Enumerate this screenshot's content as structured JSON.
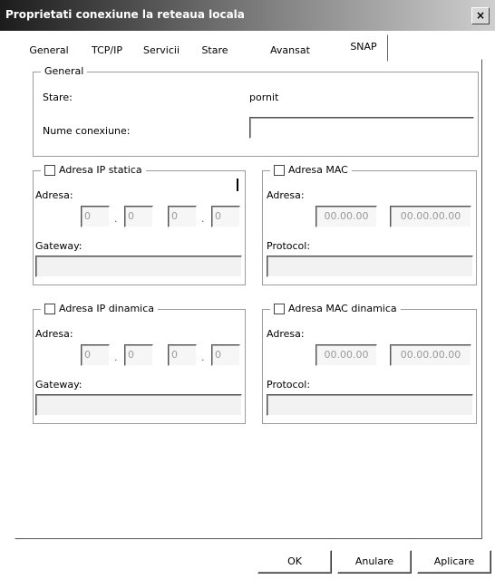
{
  "window": {
    "title": "Proprietati conexiune la reteaua locala",
    "close_glyph": "×"
  },
  "tabs": [
    {
      "label": "General"
    },
    {
      "label": "TCP/IP"
    },
    {
      "label": "Servicii"
    },
    {
      "label": "Stare"
    },
    {
      "label": "Avansat"
    },
    {
      "label": "SNAP"
    }
  ],
  "selected_tab": "SNAP",
  "general_group": {
    "legend": "General",
    "status_label": "Stare:",
    "status_value": "pornit",
    "description_label": "Nume conexiune:",
    "description_value": ""
  },
  "groups": [
    {
      "legend": "Adresa IP statica",
      "address_label": "Adresa:",
      "ip_octets": [
        "0",
        "0",
        "0",
        "0"
      ],
      "mask_label": "Gateway:"
    },
    {
      "legend": "Adresa MAC",
      "address_label": "Adresa:",
      "mac_parts": [
        "00.00.00",
        "00.00.00.00"
      ],
      "mask_label": "Protocol:"
    },
    {
      "legend": "Adresa IP dinamica",
      "address_label": "Adresa:",
      "ip_octets": [
        "0",
        "0",
        "0",
        "0"
      ],
      "mask_label": "Gateway:"
    },
    {
      "legend": "Adresa MAC dinamica",
      "address_label": "Adresa:",
      "mac_parts": [
        "00.00.00",
        "00.00.00.00"
      ],
      "mask_label": "Protocol:"
    }
  ],
  "buttons": {
    "ok": "OK",
    "cancel": "Anulare",
    "apply": "Aplicare"
  }
}
